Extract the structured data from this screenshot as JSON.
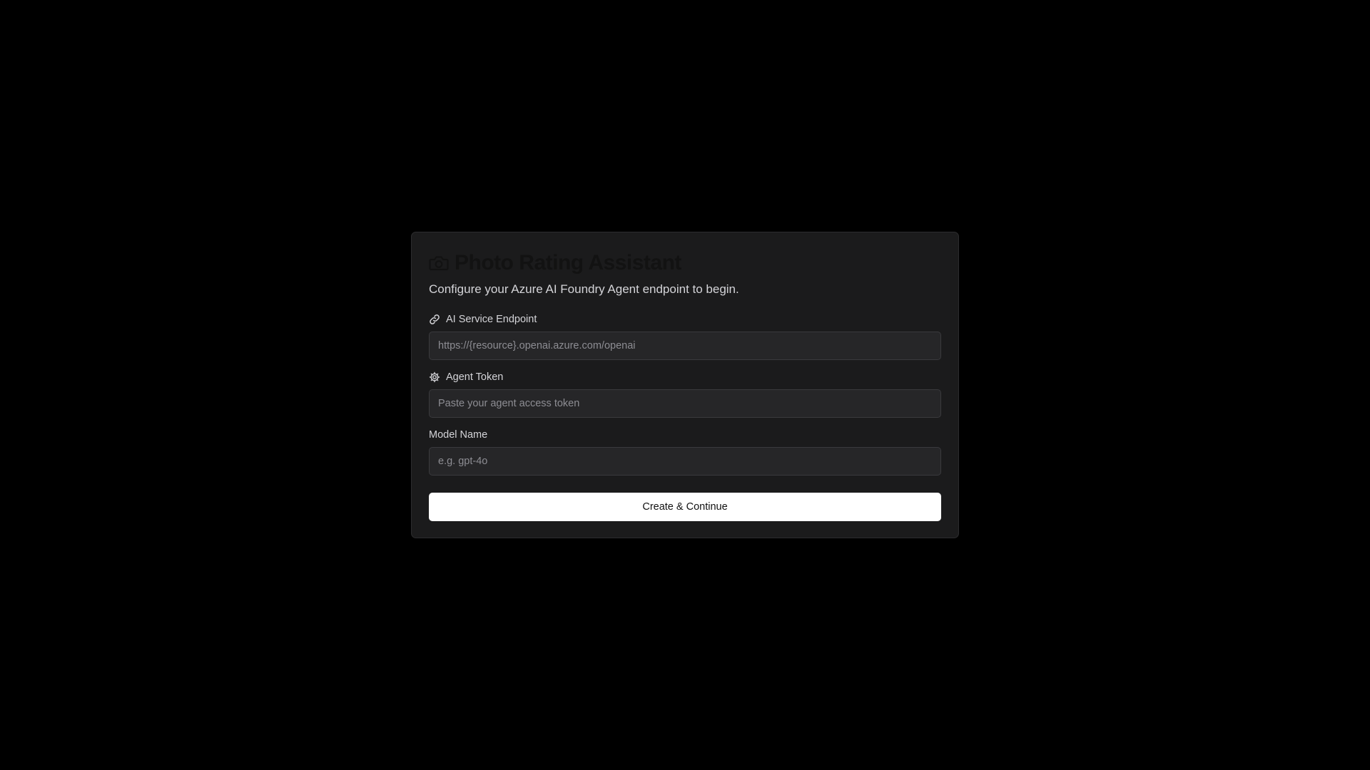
{
  "card": {
    "title": "Photo Rating Assistant",
    "title_icon": "camera-icon",
    "subtitle": "Configure your Azure AI Foundry Agent endpoint to begin."
  },
  "fields": {
    "endpoint": {
      "icon": "link-icon",
      "label": "AI Service Endpoint",
      "value": "",
      "placeholder": "https://{resource}.openai.azure.com/openai"
    },
    "token": {
      "icon": "gear-icon",
      "label": "Agent Token",
      "value": "",
      "placeholder": "Paste your agent access token"
    },
    "model": {
      "label": "Model Name",
      "value": "",
      "placeholder": "e.g. gpt-4o"
    }
  },
  "submit_label": "Create & Continue",
  "colors": {
    "background": "#000000",
    "card": "#1b1b1c",
    "input": "#262628",
    "button": "#ffffff"
  }
}
